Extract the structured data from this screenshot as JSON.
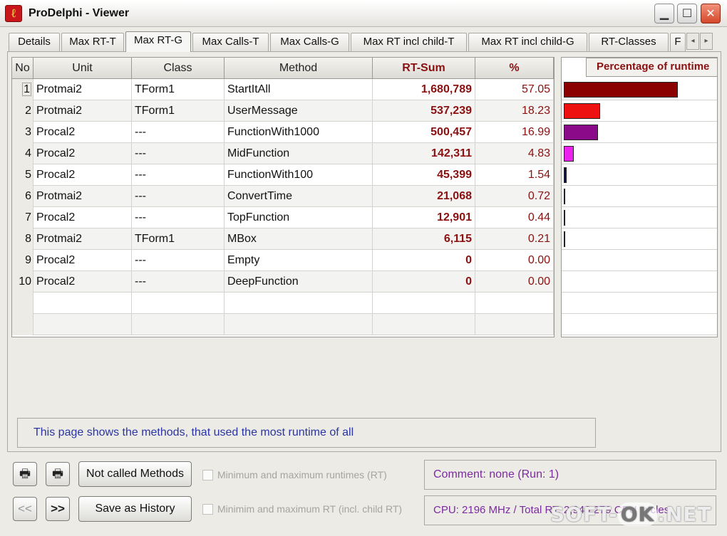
{
  "window": {
    "title": "ProDelphi - Viewer",
    "app_icon_glyph": "ℓ",
    "min_glyph": "▁",
    "max_glyph": "☐",
    "close_glyph": "✕"
  },
  "tabs": [
    {
      "label": "Details"
    },
    {
      "label": "Max RT-T"
    },
    {
      "label": "Max RT-G",
      "active": true
    },
    {
      "label": "Max Calls-T"
    },
    {
      "label": "Max Calls-G"
    },
    {
      "label": "Max RT incl child-T"
    },
    {
      "label": "Max RT incl child-G"
    },
    {
      "label": "RT-Classes"
    },
    {
      "label": "F"
    }
  ],
  "tab_scroll": {
    "left_glyph": "◂",
    "right_glyph": "▸"
  },
  "table": {
    "headers": {
      "no": "No",
      "unit": "Unit",
      "class": "Class",
      "method": "Method",
      "rt_sum": "RT-Sum",
      "pct": "%"
    },
    "rows": [
      {
        "no": "1",
        "unit": "Protmai2",
        "class": "TForm1",
        "method": "StartItAll",
        "rt_sum": "1,680,789",
        "pct": "57.05"
      },
      {
        "no": "2",
        "unit": "Protmai2",
        "class": "TForm1",
        "method": "UserMessage",
        "rt_sum": "537,239",
        "pct": "18.23"
      },
      {
        "no": "3",
        "unit": "Procal2",
        "class": "---",
        "method": "FunctionWith1000",
        "rt_sum": "500,457",
        "pct": "16.99"
      },
      {
        "no": "4",
        "unit": "Procal2",
        "class": "---",
        "method": "MidFunction",
        "rt_sum": "142,311",
        "pct": "4.83"
      },
      {
        "no": "5",
        "unit": "Procal2",
        "class": "---",
        "method": "FunctionWith100",
        "rt_sum": "45,399",
        "pct": "1.54"
      },
      {
        "no": "6",
        "unit": "Protmai2",
        "class": "---",
        "method": "ConvertTime",
        "rt_sum": "21,068",
        "pct": "0.72"
      },
      {
        "no": "7",
        "unit": "Procal2",
        "class": "---",
        "method": "TopFunction",
        "rt_sum": "12,901",
        "pct": "0.44"
      },
      {
        "no": "8",
        "unit": "Protmai2",
        "class": "TForm1",
        "method": "MBox",
        "rt_sum": "6,115",
        "pct": "0.21"
      },
      {
        "no": "9",
        "unit": "Procal2",
        "class": "---",
        "method": "Empty",
        "rt_sum": "0",
        "pct": "0.00"
      },
      {
        "no": "10",
        "unit": "Procal2",
        "class": "---",
        "method": "DeepFunction",
        "rt_sum": "0",
        "pct": "0.00"
      }
    ]
  },
  "chart": {
    "header": "Percentage of runtime",
    "bars": [
      {
        "value": 57.05,
        "color": "#8b0000"
      },
      {
        "value": 18.23,
        "color": "#ee1111"
      },
      {
        "value": 16.99,
        "color": "#8a0a8a"
      },
      {
        "value": 4.83,
        "color": "#ee22ee"
      },
      {
        "value": 1.54,
        "color": "#111144"
      },
      {
        "value": 0.72,
        "color": "#777777"
      },
      {
        "value": 0.44,
        "color": "#999999"
      },
      {
        "value": 0.21,
        "color": "#aaaaaa"
      },
      {
        "value": 0,
        "color": "#aaaaaa"
      },
      {
        "value": 0,
        "color": "#aaaaaa"
      }
    ]
  },
  "info_text": "This page shows the methods, that used the most runtime of all",
  "controls": {
    "print_icon_glyph": "🖶",
    "print2_icon_glyph": "🖶",
    "not_called_label": "Not called Methods",
    "save_history_label": "Save as History",
    "prev_label": "<<",
    "next_label": ">>",
    "check_min_max": "Minimum and maximum runtimes (RT)",
    "check_min_max_child": "Minimim and maximum RT (incl. child RT)",
    "comment": "Comment:  none (Run: 1)",
    "cpu": "CPU: 2196 MHz / Total RT: 2,946,279 CPU cycles"
  },
  "watermark": {
    "pre": "SOFT-",
    "pill": "OK",
    "post": ".NET"
  }
}
